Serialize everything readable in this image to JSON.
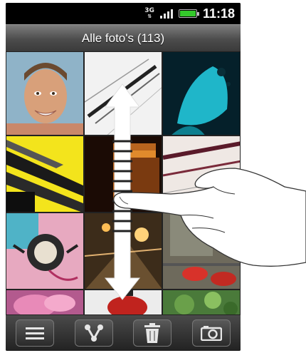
{
  "status_bar": {
    "network_type": "3G",
    "signal_icon": "signal-bars-icon",
    "battery_icon": "battery-icon",
    "battery_level": 1.0,
    "time": "11:18"
  },
  "title_bar": {
    "title": "Alle foto's (113)"
  },
  "gallery": {
    "columns": 3,
    "visible_rows": 4,
    "thumbnails": [
      {
        "subject": "smiling man portrait"
      },
      {
        "subject": "dark streaks on white"
      },
      {
        "subject": "cyan abstract figure"
      },
      {
        "subject": "yellow diagonal beams"
      },
      {
        "subject": "dark orange layers"
      },
      {
        "subject": "ink stripes on paper"
      },
      {
        "subject": "ornamental emblem collage"
      },
      {
        "subject": "sepia street lights"
      },
      {
        "subject": "red shoes on pavement"
      },
      {
        "subject": "pink flower"
      },
      {
        "subject": "red lantern"
      },
      {
        "subject": "green foliage"
      }
    ]
  },
  "bottom_bar": {
    "buttons": [
      {
        "icon": "menu-lines-icon"
      },
      {
        "icon": "share-icon"
      },
      {
        "icon": "trash-icon"
      },
      {
        "icon": "camera-icon"
      }
    ]
  },
  "gesture": {
    "icon": "vertical-scroll-arrow-icon",
    "hand_icon": "pointing-hand-icon"
  },
  "colors": {
    "battery": "#34c92b",
    "title_bar_top": "#7d7d7d",
    "title_bar_bottom": "#3a3a3a"
  }
}
